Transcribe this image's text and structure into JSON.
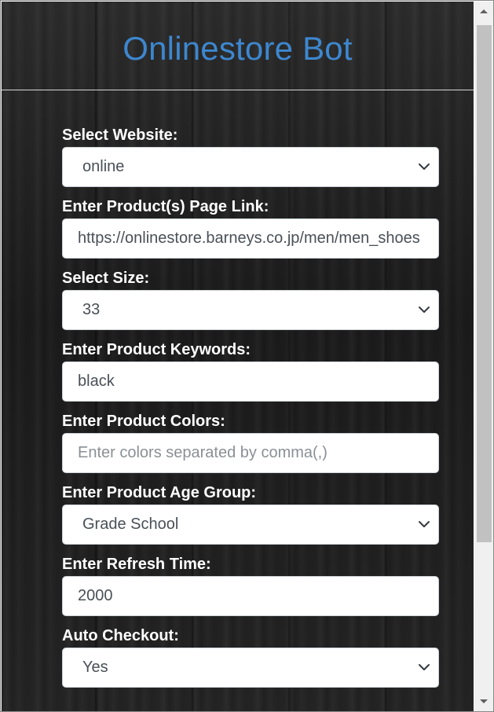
{
  "header": {
    "title": "Onlinestore Bot"
  },
  "form": {
    "fields": [
      {
        "label": "Select Website:",
        "type": "select",
        "value": "online"
      },
      {
        "label": "Enter Product(s) Page Link:",
        "type": "input",
        "value": "https://onlinestore.barneys.co.jp/men/men_shoes",
        "placeholder": ""
      },
      {
        "label": "Select Size:",
        "type": "select",
        "value": "33"
      },
      {
        "label": "Enter Product Keywords:",
        "type": "input",
        "value": "black",
        "placeholder": ""
      },
      {
        "label": "Enter Product Colors:",
        "type": "input",
        "value": "",
        "placeholder": "Enter colors separated by comma(,)"
      },
      {
        "label": "Enter Product Age Group:",
        "type": "select",
        "value": "Grade School"
      },
      {
        "label": "Enter Refresh Time:",
        "type": "input",
        "value": "2000",
        "placeholder": ""
      },
      {
        "label": "Auto Checkout:",
        "type": "select",
        "value": "Yes"
      }
    ]
  },
  "colors": {
    "title": "#3d87cf",
    "label": "#ffffff",
    "background": "#1e1e1e",
    "input_text": "#495057",
    "placeholder": "#8a9096"
  },
  "icons": {
    "select_arrow": "chevron-down-icon",
    "scroll_up": "scroll-up-arrow-icon",
    "scroll_down": "scroll-down-arrow-icon"
  }
}
